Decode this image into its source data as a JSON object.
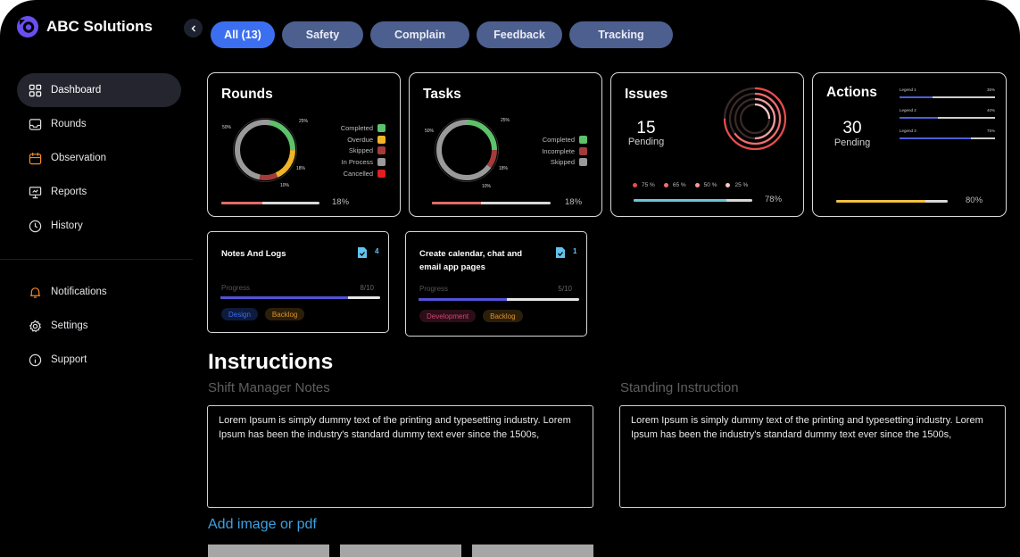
{
  "brand": {
    "name": "ABC Solutions"
  },
  "nav": {
    "main": [
      {
        "label": "Dashboard",
        "icon": "grid-icon",
        "active": true
      },
      {
        "label": "Rounds",
        "icon": "inbox-icon"
      },
      {
        "label": "Observation",
        "icon": "calendar-icon"
      },
      {
        "label": "Reports",
        "icon": "presentation-icon"
      },
      {
        "label": "History",
        "icon": "clock-icon"
      }
    ],
    "bottom": [
      {
        "label": "Notifications",
        "icon": "bell-icon"
      },
      {
        "label": "Settings",
        "icon": "gear-icon"
      },
      {
        "label": "Support",
        "icon": "info-icon"
      }
    ]
  },
  "tabs": [
    "All (13)",
    "Safety",
    "Complain",
    "Feedback",
    "Tracking"
  ],
  "colors": {
    "accent": "#3c6ff0",
    "tab": "#4d5f8f",
    "link": "#3da1e0",
    "progress": "#5552d8"
  },
  "rounds": {
    "title": "Rounds",
    "legend": [
      {
        "label": "Completed",
        "color": "#5dc26b"
      },
      {
        "label": "Overdue",
        "color": "#f0b429"
      },
      {
        "label": "Skipped",
        "color": "#a33b3b"
      },
      {
        "label": "In Process",
        "color": "#9a9a9a"
      },
      {
        "label": "Cancelled",
        "color": "#e51d1d"
      }
    ],
    "segments": [
      {
        "label": "Completed",
        "percent": 25,
        "color": "#5dc26b"
      },
      {
        "label": "Overdue",
        "percent": 18,
        "color": "#f0b429"
      },
      {
        "label": "Skipped",
        "percent": 10,
        "color": "#a33b3b"
      },
      {
        "label": "In Process",
        "percent": 50,
        "color": "#9a9a9a"
      }
    ],
    "pct_labels": [
      "50%",
      "25%",
      "18%",
      "10%"
    ],
    "progress": 0.18,
    "progress_label": "18%"
  },
  "tasks": {
    "title": "Tasks",
    "legend": [
      {
        "label": "Completed",
        "color": "#5dc26b"
      },
      {
        "label": "Incomplete",
        "color": "#a33b3b"
      },
      {
        "label": "Skipped",
        "color": "#9a9a9a"
      }
    ],
    "segments": [
      {
        "label": "Completed",
        "percent": 25,
        "color": "#5dc26b"
      },
      {
        "label": "Incomplete",
        "percent": 10,
        "color": "#a33b3b"
      },
      {
        "label": "Skipped",
        "percent": 65,
        "color": "#9a9a9a"
      }
    ],
    "pct_labels": [
      "50%",
      "25%",
      "18%",
      "10%"
    ],
    "progress": 0.18,
    "progress_label": "18%"
  },
  "issues": {
    "title": "Issues",
    "count": "15",
    "sub": "Pending",
    "rings": [
      75,
      65,
      50,
      25
    ],
    "legend": [
      "75 %",
      "65 %",
      "50 %",
      "25 %"
    ],
    "legend_colors": [
      "#e84c4c",
      "#f26d6d",
      "#f59a9a",
      "#fbc7c7"
    ],
    "progress": 0.78,
    "progress_label": "78%"
  },
  "actions": {
    "title": "Actions",
    "count": "30",
    "sub": "Pending",
    "bars": [
      {
        "label": "Legend 1",
        "value": "35%",
        "fraction": 0.35
      },
      {
        "label": "Legend 2",
        "value": "40%",
        "fraction": 0.4
      },
      {
        "label": "Legend 3",
        "value": "75%",
        "fraction": 0.75
      }
    ],
    "progress": 0.8,
    "progress_label": "80%"
  },
  "task_cards": [
    {
      "title": "Notes And Logs",
      "count": "4",
      "progress_label": "Progress",
      "progress_value": "8/10",
      "progress": 0.8,
      "tags": [
        {
          "label": "Design",
          "color": "#3b6df2",
          "bg": "#0e1b3d"
        },
        {
          "label": "Backlog",
          "color": "#d9922c",
          "bg": "#2c1f0a"
        }
      ]
    },
    {
      "title": "Create calendar, chat and email app pages",
      "count": "1",
      "progress_label": "Progress",
      "progress_value": "5/10",
      "progress": 0.55,
      "tags": [
        {
          "label": "Development",
          "color": "#d3446e",
          "bg": "#2c0e19"
        },
        {
          "label": "Backlog",
          "color": "#d9922c",
          "bg": "#2c1f0a"
        }
      ]
    }
  ],
  "instructions": {
    "title": "Instructions",
    "shift": {
      "label": "Shift Manager Notes",
      "text": "Lorem Ipsum is simply dummy text of the printing and typesetting industry. Lorem Ipsum has been the industry's standard dummy text ever since the 1500s,"
    },
    "standing": {
      "label": "Standing Instruction",
      "text": "Lorem Ipsum is simply dummy text of the printing and typesetting industry. Lorem Ipsum has been the industry's standard dummy text ever since the 1500s,"
    },
    "add_label": "Add image or pdf"
  }
}
